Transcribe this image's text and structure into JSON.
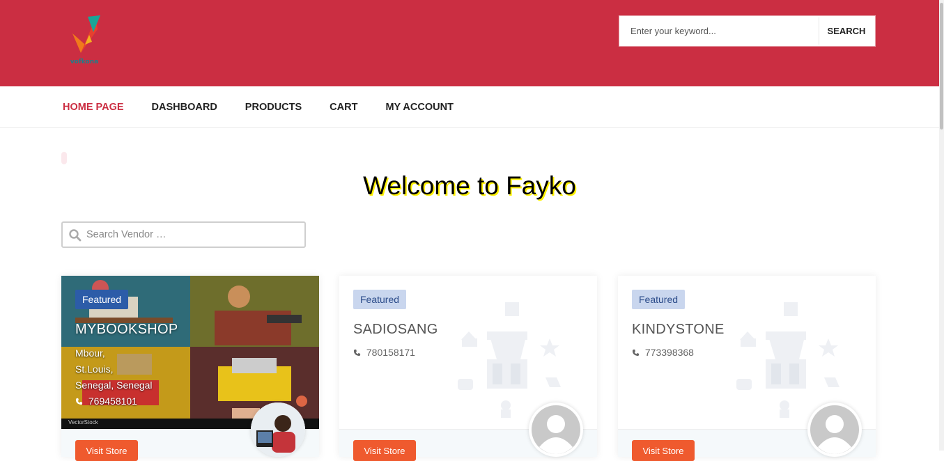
{
  "header": {
    "logo_text": "vofkona",
    "search_placeholder": "Enter your keyword...",
    "search_button": "SEARCH"
  },
  "nav": {
    "items": [
      {
        "label": "HOME PAGE",
        "active": true
      },
      {
        "label": "DASHBOARD",
        "active": false
      },
      {
        "label": "PRODUCTS",
        "active": false
      },
      {
        "label": "CART",
        "active": false
      },
      {
        "label": "MY ACCOUNT",
        "active": false
      }
    ]
  },
  "main": {
    "welcome": "Welcome to Fayko",
    "vendor_search_placeholder": "Search Vendor …"
  },
  "stores": [
    {
      "badge": "Featured",
      "name": "MYBOOKSHOP",
      "address": [
        "Mbour,",
        "St.Louis,",
        "Senegal, Senegal"
      ],
      "phone": "769458101",
      "visit": "Visit Store",
      "image_caption": "VectorStock"
    },
    {
      "badge": "Featured",
      "name": "SADIOSANG",
      "phone": "780158171",
      "visit": "Visit Store"
    },
    {
      "badge": "Featured",
      "name": "KINDYSTONE",
      "phone": "773398368",
      "visit": "Visit Store"
    }
  ],
  "colors": {
    "brand": "#cb2e42",
    "featured_badge": "#2c5ca8",
    "visit_button": "#ef5a2e",
    "welcome_shadow": "#fff200"
  }
}
